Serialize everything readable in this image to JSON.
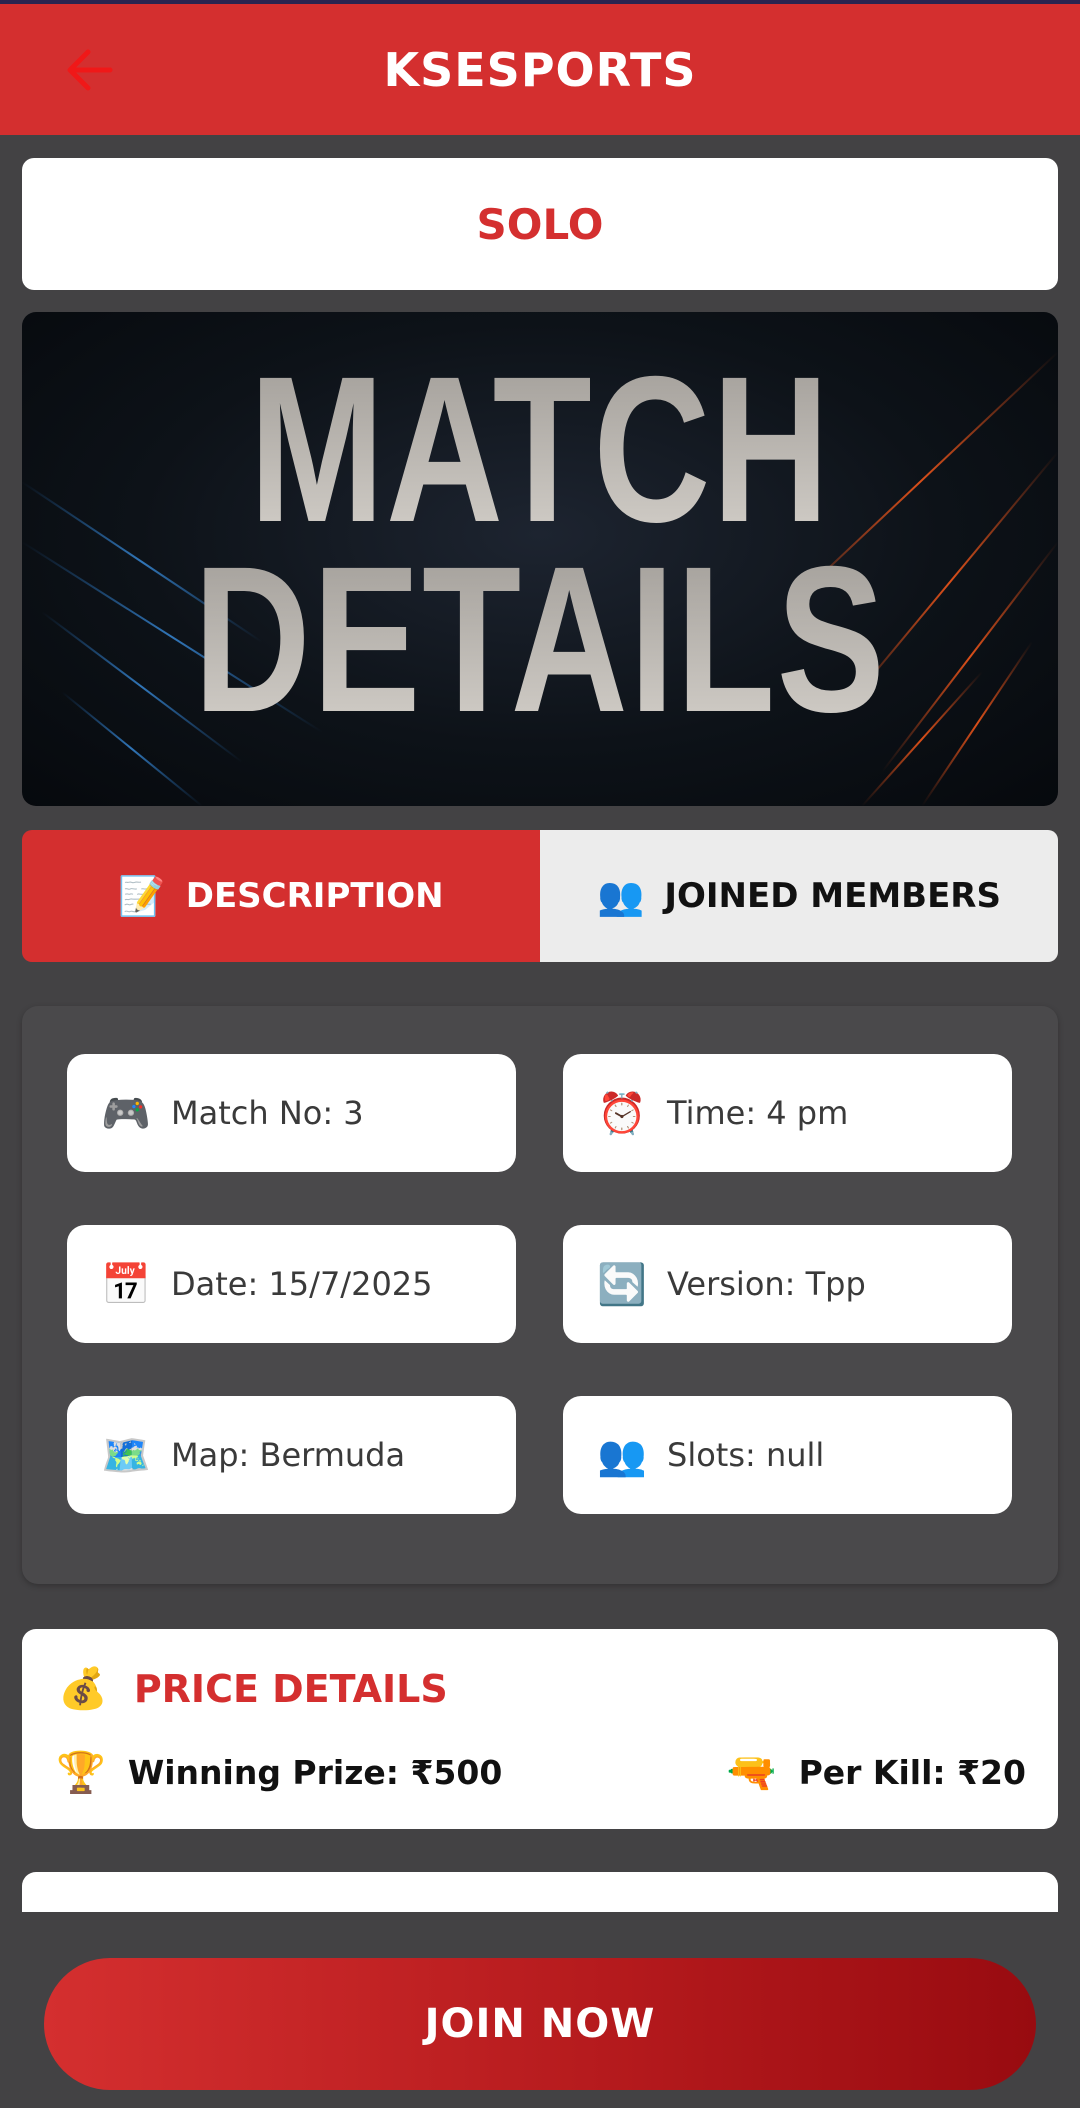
{
  "app": {
    "title": "KSESPORTS",
    "back_icon": "arrow-left-icon"
  },
  "colors": {
    "primary": "#d42f2f",
    "background": "#434244",
    "card": "#ffffff",
    "tab_inactive": "#ececec"
  },
  "mode": {
    "label": "SOLO"
  },
  "banner": {
    "line1": "MATCH",
    "line2": "DETAILS"
  },
  "tabs": [
    {
      "label": "DESCRIPTION",
      "icon": "📝",
      "active": true
    },
    {
      "label": "JOINED MEMBERS",
      "icon": "👥",
      "active": false
    }
  ],
  "details": [
    {
      "icon": "🎮",
      "text": "Match No: 3"
    },
    {
      "icon": "⏰",
      "text": "Time: 4 pm"
    },
    {
      "icon": "📅",
      "text": "Date: 15/7/2025"
    },
    {
      "icon": "🔄",
      "text": "Version: Tpp"
    },
    {
      "icon": "🗺️",
      "text": "Map: Bermuda"
    },
    {
      "icon": "👥",
      "text": "Slots: null"
    }
  ],
  "price": {
    "icon": "💰",
    "title": "PRICE DETAILS",
    "winning": {
      "icon": "🏆",
      "text": "Winning Prize: ₹500"
    },
    "per_kill": {
      "icon": "🔫",
      "text": "Per Kill: ₹20"
    }
  },
  "cta": {
    "label": "JOIN NOW"
  }
}
